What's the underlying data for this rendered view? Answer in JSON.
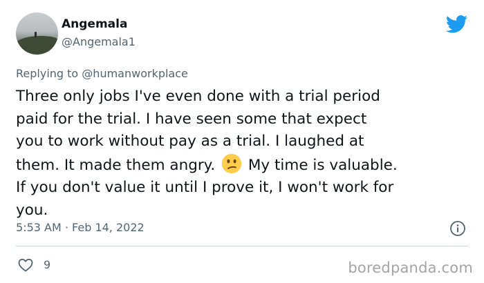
{
  "tweet": {
    "author": {
      "display_name": "Angemala",
      "handle": "@Angemala1",
      "avatar_icon": "mountain-avatar"
    },
    "platform_icon": "twitter-bird-icon",
    "brand_color": "#1d9bf0",
    "replying_prefix": "Replying to",
    "replying_to": "@humanworkplace",
    "text_lines": [
      "Three only jobs I've even done with a trial period",
      "paid for the trial. I have seen some that expect",
      "you to work without pay as a trial. I laughed at",
      "them. It made them angry.",
      "My time is valuable.",
      "If you don't value it until I prove it, I won't work for",
      "you."
    ],
    "emoji": "confused-face-emoji",
    "timestamp": "5:53 AM · Feb 14, 2022",
    "info_icon": "info-icon",
    "like_icon": "heart-icon",
    "like_count": "9"
  },
  "watermark": "boredpanda.com"
}
